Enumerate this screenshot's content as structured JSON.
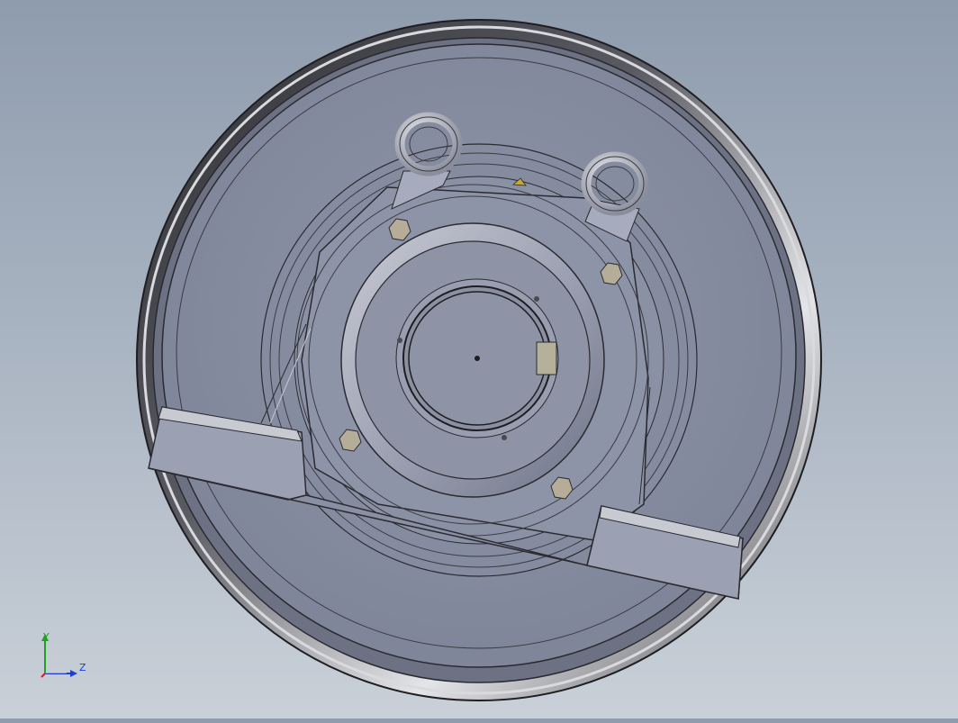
{
  "viewport": {
    "colors": {
      "background_top": "#8f9cad",
      "background_bottom": "#c9d0d8",
      "part_face": "#8a90a3",
      "rim_dark": "#3a3a40",
      "rim_light": "#d6d8dd",
      "edge": "#2a2a30",
      "bolt": "#b8b09a"
    }
  },
  "model": {
    "components": [
      "wheel-rim",
      "wheel-disc",
      "bearing-housing",
      "mounting-feet",
      "lifting-eye-bolts",
      "hex-bolts",
      "shaft-bore"
    ]
  },
  "triad": {
    "y_label": "Y",
    "z_label": "Z",
    "colors": {
      "y_axis": "#1fa31f",
      "z_axis": "#1f3fcf",
      "x_axis": "#cf1f1f"
    }
  }
}
